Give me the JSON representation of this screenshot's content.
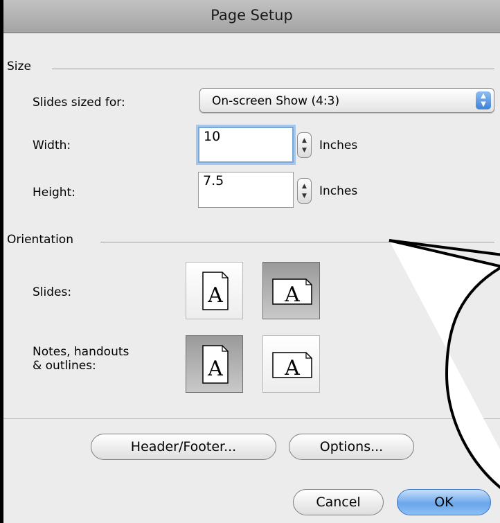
{
  "window": {
    "title": "Page Setup"
  },
  "size": {
    "section_label": "Size",
    "slides_sized_for_label": "Slides sized for:",
    "slides_sized_for_value": "On-screen Show (4:3)",
    "width_label": "Width:",
    "width_value": "10",
    "width_unit": "Inches",
    "height_label": "Height:",
    "height_value": "7.5",
    "height_unit": "Inches"
  },
  "orientation": {
    "section_label": "Orientation",
    "slides_label": "Slides:",
    "notes_label_line1": "Notes, handouts",
    "notes_label_line2": "& outlines:",
    "glyph": "A",
    "slides_selected": "landscape",
    "notes_selected": "portrait"
  },
  "buttons": {
    "header_footer": "Header/Footer...",
    "options": "Options...",
    "cancel": "Cancel",
    "ok": "OK"
  },
  "icons": {
    "popup_arrows": "updown-arrows-icon",
    "stepper": "stepper-icon",
    "portrait_page": "portrait-page-icon",
    "landscape_page": "landscape-page-icon"
  },
  "colors": {
    "accent": "#6aa6ea",
    "window_bg": "#ececec"
  }
}
